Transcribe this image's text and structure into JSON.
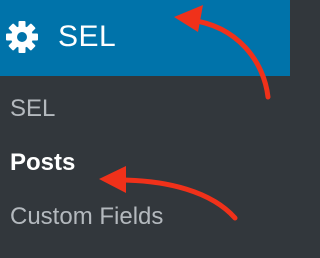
{
  "menu": {
    "title": "SEL",
    "icon": "gear-icon",
    "header_color": "#0073aa",
    "background_color": "#32373c"
  },
  "submenu": {
    "items": [
      {
        "label": "SEL",
        "current": false
      },
      {
        "label": "Posts",
        "current": true
      },
      {
        "label": "Custom Fields",
        "current": false
      }
    ]
  },
  "annotations": {
    "arrow_color": "#f0311a",
    "arrows": [
      "arrow-to-menu-title",
      "arrow-to-posts"
    ]
  }
}
